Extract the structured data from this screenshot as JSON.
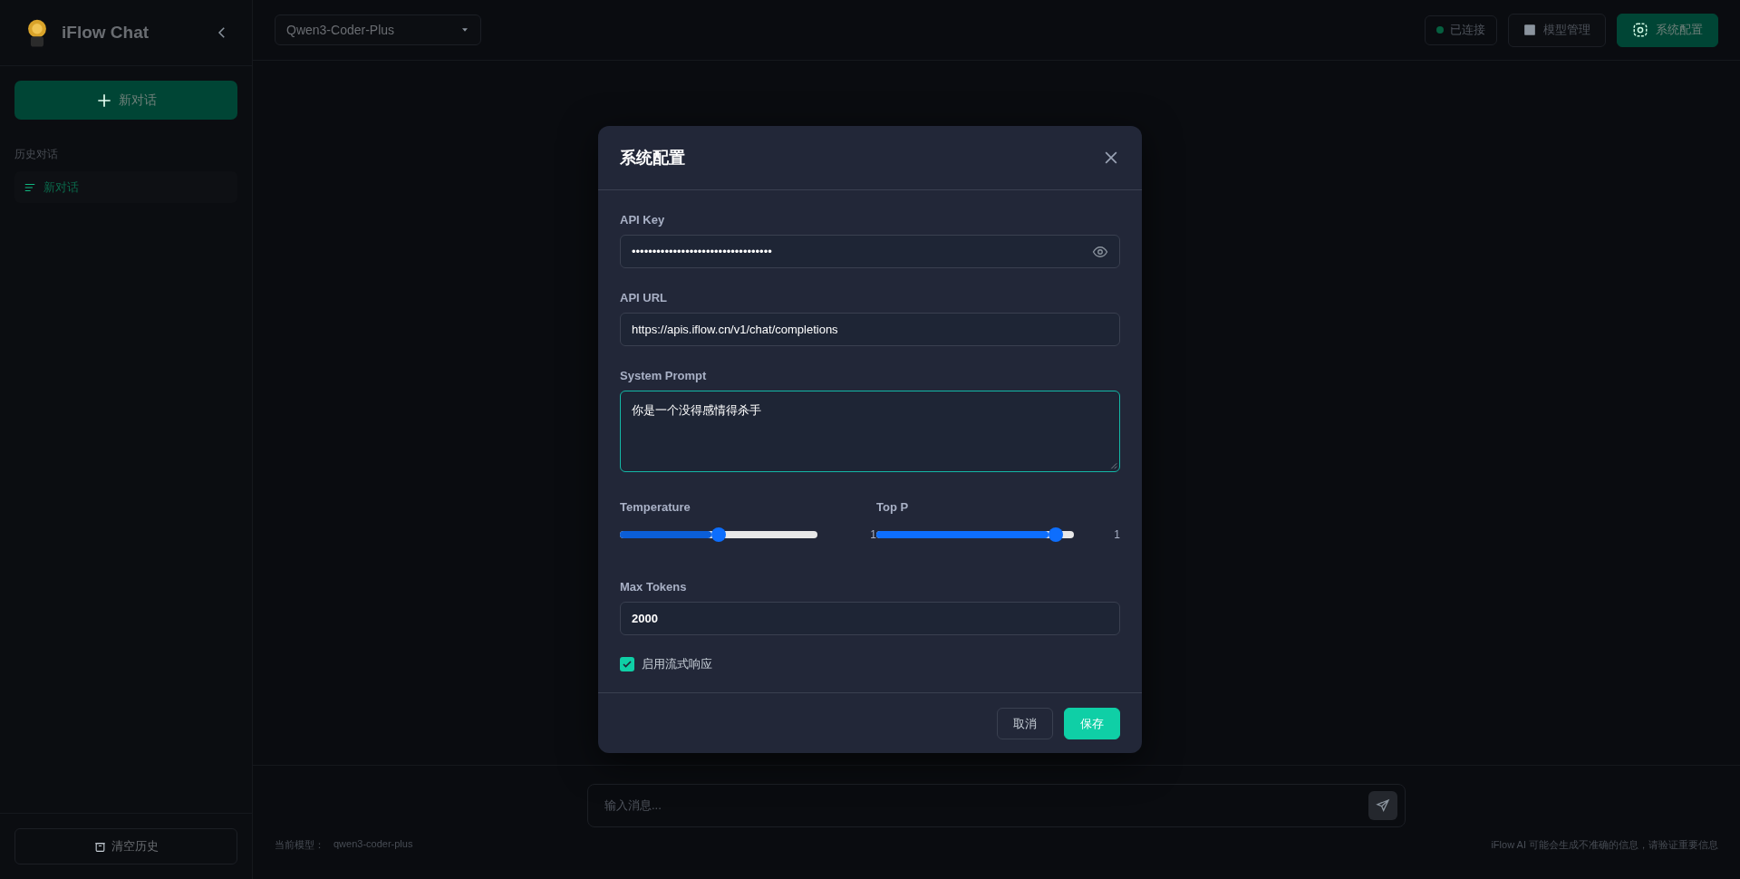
{
  "sidebar": {
    "app_name": "iFlow Chat",
    "new_chat_button": "新对话",
    "history_heading": "历史对话",
    "history": [
      {
        "label": "新对话",
        "selected": true
      }
    ],
    "clear_button": "清空历史"
  },
  "topbar": {
    "model_select": "Qwen3-Coder-Plus",
    "status": {
      "label": "已连接",
      "connected": true
    },
    "buttons": [
      {
        "label": "模型管理",
        "kind": "models"
      },
      {
        "label": "系统配置",
        "kind": "settings"
      }
    ]
  },
  "composer": {
    "placeholder": "输入消息...",
    "current_model_label": "当前模型：",
    "current_model": "qwen3-coder-plus",
    "disclaimer": "iFlow AI 可能会生成不准确的信息，请验证重要信息"
  },
  "dialog": {
    "title": "系统配置",
    "fields": [
      {
        "kind": "password",
        "label": "API Key",
        "value": "••••••••••••••••••••••••••••••••••",
        "focused": false
      },
      {
        "kind": "text",
        "label": "API URL",
        "value": "https://apis.iflow.cn/v1/chat/completions",
        "focused": false
      },
      {
        "kind": "textarea",
        "label": "System Prompt",
        "value": "你是一个没得感情得杀手",
        "focused": true
      }
    ],
    "sliders": [
      {
        "label": "Temperature",
        "level": 0.5,
        "reading": "1"
      },
      {
        "label": "Top P",
        "level": 0.91,
        "reading": "1"
      }
    ],
    "max_tokens": {
      "label": "Max Tokens",
      "value": "2000"
    },
    "stream": {
      "label": "启用流式响应",
      "checked": true
    },
    "buttons": [
      {
        "label": "取消",
        "kind": "secondary"
      },
      {
        "label": "保存",
        "kind": "primary"
      }
    ]
  }
}
